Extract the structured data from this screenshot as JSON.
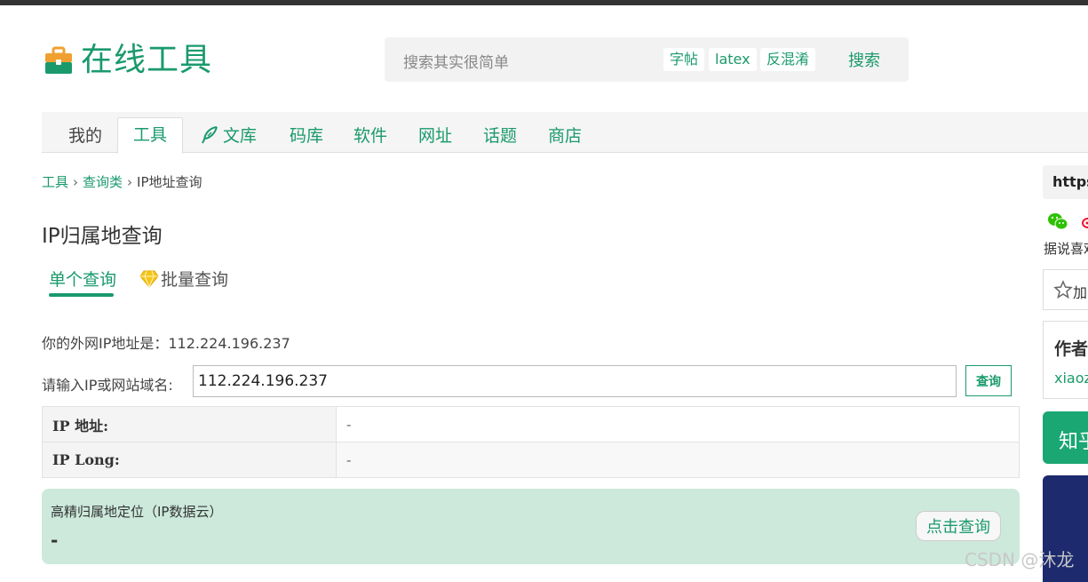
{
  "header": {
    "site_title": "在线工具",
    "search_placeholder": "搜索其实很简单",
    "search_chips": [
      "字帖",
      "latex",
      "反混淆"
    ],
    "search_button": "搜索"
  },
  "nav": {
    "items": [
      "我的",
      "工具",
      "文库",
      "码库",
      "软件",
      "网址",
      "话题",
      "商店"
    ],
    "active_index": 1
  },
  "breadcrumb": {
    "items": [
      "工具",
      "查询类",
      "IP地址查询"
    ],
    "separator": "›"
  },
  "page": {
    "title": "IP归属地查询",
    "tabs": [
      "单个查询",
      "批量查询"
    ],
    "ip_label": "你的外网IP地址是：",
    "ip_value": "112.224.196.237",
    "query_label": "请输入IP或网站域名:",
    "query_value": "112.224.196.237",
    "query_button": "查询"
  },
  "result": {
    "rows": [
      {
        "key": "IP 地址:",
        "value": "-"
      },
      {
        "key": "IP Long:",
        "value": "-"
      }
    ]
  },
  "high_precision": {
    "title": "高精归属地定位（IP数据云）",
    "value": "-",
    "button": "点击查询"
  },
  "sidebar": {
    "url_text": "https",
    "share_text": "据说喜欢",
    "favorite_label": "加",
    "author_title": "作者",
    "author_name": "xiaoz",
    "green_banner_text": "知乎"
  },
  "watermark": "CSDN @沐龙",
  "colors": {
    "brand": "#1a9a6c",
    "highlight_bg": "#cce9dc",
    "dark_banner": "#1d2a6e"
  },
  "icons": [
    "briefcase-icon",
    "feather-icon",
    "diamond-icon",
    "wechat-icon",
    "weibo-icon",
    "star-icon"
  ]
}
